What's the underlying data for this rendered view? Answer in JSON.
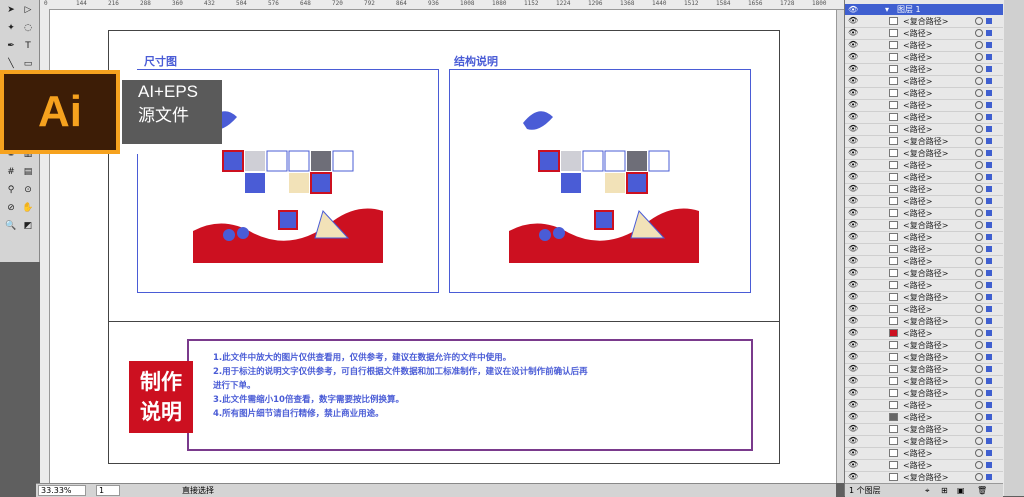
{
  "app": {
    "name": "Adobe Illustrator"
  },
  "ruler": {
    "ticks": [
      "0",
      "144",
      "216",
      "288",
      "360",
      "432",
      "504",
      "576",
      "648",
      "720",
      "792",
      "864",
      "936",
      "1008",
      "1080",
      "1152",
      "1224",
      "1296",
      "1368",
      "1440",
      "1512",
      "1584",
      "1656",
      "1728",
      "1800",
      "1872"
    ]
  },
  "tools": {
    "icons": [
      "selection-icon",
      "direct-selection-icon",
      "magic-wand-icon",
      "lasso-icon",
      "pen-icon",
      "type-icon",
      "line-icon",
      "rectangle-icon",
      "paintbrush-icon",
      "pencil-icon",
      "blob-brush-icon",
      "eraser-icon",
      "rotate-icon",
      "scale-icon",
      "warp-icon",
      "free-transform-icon",
      "symbol-sprayer-icon",
      "graph-icon",
      "mesh-icon",
      "gradient-icon",
      "eyedropper-icon",
      "blend-icon",
      "slice-icon",
      "hand-icon",
      "zoom-icon",
      "fill-stroke-icon"
    ]
  },
  "badge": {
    "logo": "Ai",
    "line1": "AI+EPS",
    "line2": "源文件"
  },
  "artboard": {
    "left_title": "尺寸图",
    "right_title": "结构说明"
  },
  "notes": {
    "seal_line1": "制作",
    "seal_line2": "说明",
    "lines": [
      "1.此文件中放大的图片仅供查看用，仅供参考，建议在数据允许的文件中使用。",
      "2.用于标注的说明文字仅供参考，可自行根据文件数据和加工标准制作，建议在设计制作前确认后再",
      "进行下单。",
      "3.此文件需缩小10倍查看，数字需要按比例换算。",
      "4.所有图片细节请自行精修，禁止商业用途。"
    ]
  },
  "layers": {
    "header": "图层 1",
    "footer": "1 个图层",
    "rows": [
      {
        "name": "<复合路径>",
        "color": "#ffffff"
      },
      {
        "name": "<路径>",
        "color": "#ffffff"
      },
      {
        "name": "<路径>",
        "color": "#ffffff"
      },
      {
        "name": "<路径>",
        "color": "#ffffff"
      },
      {
        "name": "<路径>",
        "color": "#ffffff"
      },
      {
        "name": "<路径>",
        "color": "#ffffff"
      },
      {
        "name": "<路径>",
        "color": "#ffffff"
      },
      {
        "name": "<路径>",
        "color": "#ffffff"
      },
      {
        "name": "<路径>",
        "color": "#ffffff"
      },
      {
        "name": "<路径>",
        "color": "#ffffff"
      },
      {
        "name": "<复合路径>",
        "color": "#ffffff"
      },
      {
        "name": "<复合路径>",
        "color": "#ffffff"
      },
      {
        "name": "<路径>",
        "color": "#ffffff"
      },
      {
        "name": "<路径>",
        "color": "#ffffff"
      },
      {
        "name": "<路径>",
        "color": "#ffffff"
      },
      {
        "name": "<路径>",
        "color": "#ffffff"
      },
      {
        "name": "<路径>",
        "color": "#ffffff"
      },
      {
        "name": "<复合路径>",
        "color": "#ffffff"
      },
      {
        "name": "<路径>",
        "color": "#ffffff"
      },
      {
        "name": "<路径>",
        "color": "#ffffff"
      },
      {
        "name": "<路径>",
        "color": "#ffffff"
      },
      {
        "name": "<复合路径>",
        "color": "#ffffff"
      },
      {
        "name": "<路径>",
        "color": "#ffffff"
      },
      {
        "name": "<复合路径>",
        "color": "#ffffff"
      },
      {
        "name": "<路径>",
        "color": "#ffffff"
      },
      {
        "name": "<复合路径>",
        "color": "#ffffff"
      },
      {
        "name": "<路径>",
        "color": "#cc1020"
      },
      {
        "name": "<复合路径>",
        "color": "#ffffff"
      },
      {
        "name": "<复合路径>",
        "color": "#ffffff"
      },
      {
        "name": "<复合路径>",
        "color": "#ffffff"
      },
      {
        "name": "<复合路径>",
        "color": "#ffffff"
      },
      {
        "name": "<复合路径>",
        "color": "#ffffff"
      },
      {
        "name": "<路径>",
        "color": "#ffffff"
      },
      {
        "name": "<路径>",
        "color": "#666666"
      },
      {
        "name": "<复合路径>",
        "color": "#ffffff"
      },
      {
        "name": "<复合路径>",
        "color": "#ffffff"
      },
      {
        "name": "<路径>",
        "color": "#ffffff"
      },
      {
        "name": "<路径>",
        "color": "#ffffff"
      },
      {
        "name": "<复合路径>",
        "color": "#ffffff"
      },
      {
        "name": "<路径>",
        "color": "#ffffff"
      }
    ]
  },
  "status": {
    "zoom": "33.33%",
    "artboard_no": "1",
    "tool": "直接选择"
  },
  "colors": {
    "accent": "#4a5cd6",
    "red": "#cc1020",
    "purple": "#7a3a8c"
  }
}
